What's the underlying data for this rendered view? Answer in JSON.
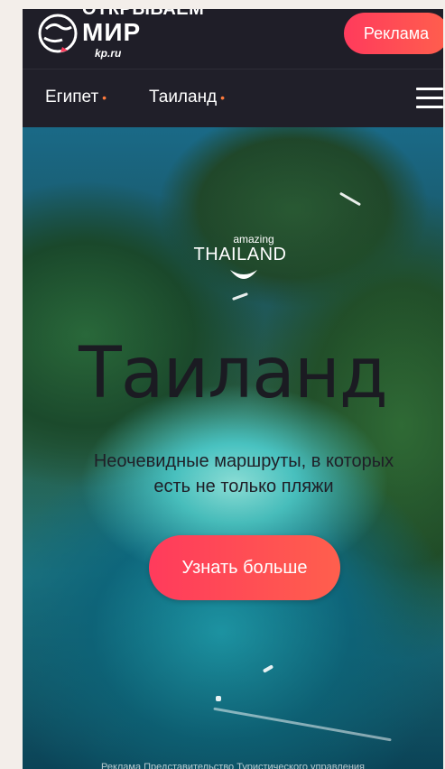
{
  "header": {
    "logo_top": "ОТКРЫВАЕМ",
    "logo_main": "МИР",
    "logo_sub": "kp.ru",
    "ad_button": "Реклама"
  },
  "nav": {
    "items": [
      {
        "label": "Египет"
      },
      {
        "label": "Таиланд"
      }
    ],
    "dot": "•"
  },
  "hero": {
    "brand_small": "amazing",
    "brand_main": "THAILAND",
    "title": "Таиланд",
    "subtitle": "Неочевидные маршруты, в которых есть не только пляжи",
    "cta": "Узнать больше",
    "disclaimer": "Реклама Представительство Туристического управления"
  },
  "colors": {
    "accent": "#ff3b5c",
    "accent_end": "#ff5f4d",
    "header_bg": "#1f1e28",
    "nav_dot": "#ff7a3c"
  }
}
